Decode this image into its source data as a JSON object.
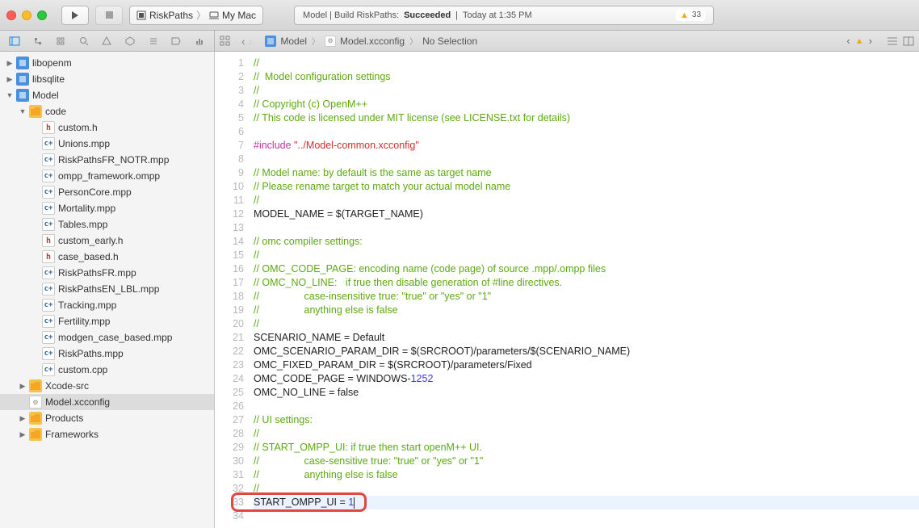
{
  "toolbar": {
    "scheme_project": "RiskPaths",
    "scheme_dest": "My Mac",
    "status_prefix": "Model | Build RiskPaths:",
    "status_result": "Succeeded",
    "status_time": "Today at 1:35 PM",
    "warn_count": "33"
  },
  "breadcrumb": {
    "root": "Model",
    "file": "Model.xcconfig",
    "tail": "No Selection"
  },
  "navigator": {
    "projects": [
      {
        "name": "libopenm",
        "kind": "proj",
        "open": false,
        "depth": 1
      },
      {
        "name": "libsqlite",
        "kind": "proj",
        "open": false,
        "depth": 1
      },
      {
        "name": "Model",
        "kind": "proj",
        "open": true,
        "depth": 1
      },
      {
        "name": "code",
        "kind": "folder",
        "open": true,
        "depth": 2
      },
      {
        "name": "custom.h",
        "kind": "h",
        "depth": 3
      },
      {
        "name": "Unions.mpp",
        "kind": "c",
        "depth": 3
      },
      {
        "name": "RiskPathsFR_NOTR.mpp",
        "kind": "c",
        "depth": 3
      },
      {
        "name": "ompp_framework.ompp",
        "kind": "c",
        "depth": 3
      },
      {
        "name": "PersonCore.mpp",
        "kind": "c",
        "depth": 3
      },
      {
        "name": "Mortality.mpp",
        "kind": "c",
        "depth": 3
      },
      {
        "name": "Tables.mpp",
        "kind": "c",
        "depth": 3
      },
      {
        "name": "custom_early.h",
        "kind": "h",
        "depth": 3
      },
      {
        "name": "case_based.h",
        "kind": "h",
        "depth": 3
      },
      {
        "name": "RiskPathsFR.mpp",
        "kind": "c",
        "depth": 3
      },
      {
        "name": "RiskPathsEN_LBL.mpp",
        "kind": "c",
        "depth": 3
      },
      {
        "name": "Tracking.mpp",
        "kind": "c",
        "depth": 3
      },
      {
        "name": "Fertility.mpp",
        "kind": "c",
        "depth": 3
      },
      {
        "name": "modgen_case_based.mpp",
        "kind": "c",
        "depth": 3
      },
      {
        "name": "RiskPaths.mpp",
        "kind": "c",
        "depth": 3
      },
      {
        "name": "custom.cpp",
        "kind": "c",
        "depth": 3
      },
      {
        "name": "Xcode-src",
        "kind": "folder",
        "open": false,
        "depth": 2
      },
      {
        "name": "Model.xcconfig",
        "kind": "cfg",
        "depth": 2,
        "sel": true
      },
      {
        "name": "Products",
        "kind": "folder",
        "open": false,
        "depth": 2
      },
      {
        "name": "Frameworks",
        "kind": "folder",
        "open": false,
        "depth": 2
      }
    ]
  },
  "code": {
    "lines": [
      {
        "n": 1,
        "segs": [
          [
            "cm",
            "//"
          ]
        ]
      },
      {
        "n": 2,
        "segs": [
          [
            "cm",
            "//  Model configuration settings"
          ]
        ]
      },
      {
        "n": 3,
        "segs": [
          [
            "cm",
            "//"
          ]
        ]
      },
      {
        "n": 4,
        "segs": [
          [
            "cm",
            "// Copyright (c) OpenM++"
          ]
        ]
      },
      {
        "n": 5,
        "segs": [
          [
            "cm",
            "// This code is licensed under MIT license (see LICENSE.txt for details)"
          ]
        ]
      },
      {
        "n": 6,
        "segs": []
      },
      {
        "n": 7,
        "segs": [
          [
            "kw",
            "#include "
          ],
          [
            "str",
            "\"../Model-common.xcconfig\""
          ]
        ]
      },
      {
        "n": 8,
        "segs": []
      },
      {
        "n": 9,
        "segs": [
          [
            "cm",
            "// Model name: by default is the same as target name"
          ]
        ]
      },
      {
        "n": 10,
        "segs": [
          [
            "cm",
            "// Please rename target to match your actual model name"
          ]
        ]
      },
      {
        "n": 11,
        "segs": [
          [
            "cm",
            "//"
          ]
        ]
      },
      {
        "n": 12,
        "segs": [
          [
            "plain",
            "MODEL_NAME = $(TARGET_NAME)"
          ]
        ]
      },
      {
        "n": 13,
        "segs": []
      },
      {
        "n": 14,
        "segs": [
          [
            "cm",
            "// omc compiler settings:"
          ]
        ]
      },
      {
        "n": 15,
        "segs": [
          [
            "cm",
            "//"
          ]
        ]
      },
      {
        "n": 16,
        "segs": [
          [
            "cm",
            "// OMC_CODE_PAGE: encoding name (code page) of source .mpp/.ompp files"
          ]
        ]
      },
      {
        "n": 17,
        "segs": [
          [
            "cm",
            "// OMC_NO_LINE:   if true then disable generation of #line directives."
          ]
        ]
      },
      {
        "n": 18,
        "segs": [
          [
            "cm",
            "//                case-insensitive true: \"true\" or \"yes\" or \"1\""
          ]
        ]
      },
      {
        "n": 19,
        "segs": [
          [
            "cm",
            "//                anything else is false"
          ]
        ]
      },
      {
        "n": 20,
        "segs": [
          [
            "cm",
            "//"
          ]
        ]
      },
      {
        "n": 21,
        "segs": [
          [
            "plain",
            "SCENARIO_NAME = Default"
          ]
        ]
      },
      {
        "n": 22,
        "segs": [
          [
            "plain",
            "OMC_SCENARIO_PARAM_DIR = $(SRCROOT)/parameters/$(SCENARIO_NAME)"
          ]
        ]
      },
      {
        "n": 23,
        "segs": [
          [
            "plain",
            "OMC_FIXED_PARAM_DIR = $(SRCROOT)/parameters/Fixed"
          ]
        ]
      },
      {
        "n": 24,
        "segs": [
          [
            "plain",
            "OMC_CODE_PAGE = WINDOWS-"
          ],
          [
            "num",
            "1252"
          ]
        ]
      },
      {
        "n": 25,
        "segs": [
          [
            "plain",
            "OMC_NO_LINE = false"
          ]
        ]
      },
      {
        "n": 26,
        "segs": []
      },
      {
        "n": 27,
        "segs": [
          [
            "cm",
            "// UI settings:"
          ]
        ]
      },
      {
        "n": 28,
        "segs": [
          [
            "cm",
            "//"
          ]
        ]
      },
      {
        "n": 29,
        "segs": [
          [
            "cm",
            "// START_OMPP_UI: if true then start openM++ UI."
          ]
        ]
      },
      {
        "n": 30,
        "segs": [
          [
            "cm",
            "//                case-sensitive true: \"true\" or \"yes\" or \"1\""
          ]
        ]
      },
      {
        "n": 31,
        "segs": [
          [
            "cm",
            "//                anything else is false"
          ]
        ]
      },
      {
        "n": 32,
        "segs": [
          [
            "cm",
            "//"
          ]
        ]
      },
      {
        "n": 33,
        "segs": [
          [
            "plain",
            "START_OMPP_UI = "
          ],
          [
            "num",
            "1"
          ]
        ],
        "hl": true,
        "cursor": true,
        "annot": true
      },
      {
        "n": 34,
        "segs": []
      }
    ]
  }
}
